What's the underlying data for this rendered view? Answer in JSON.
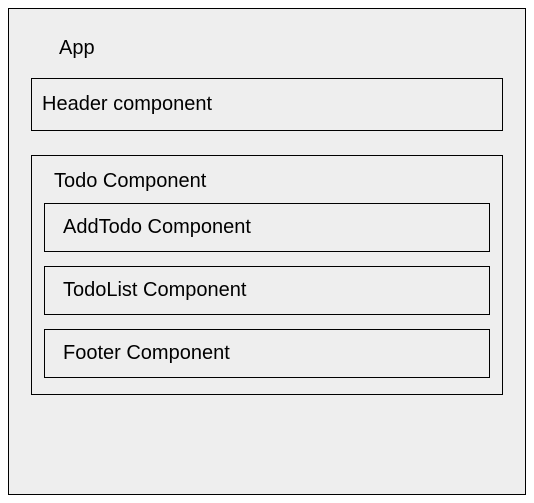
{
  "app": {
    "title": "App",
    "header": {
      "label": "Header component"
    },
    "todo": {
      "title": "Todo Component",
      "children": [
        {
          "label": "AddTodo Component"
        },
        {
          "label": "TodoList Component"
        },
        {
          "label": "Footer Component"
        }
      ]
    }
  }
}
